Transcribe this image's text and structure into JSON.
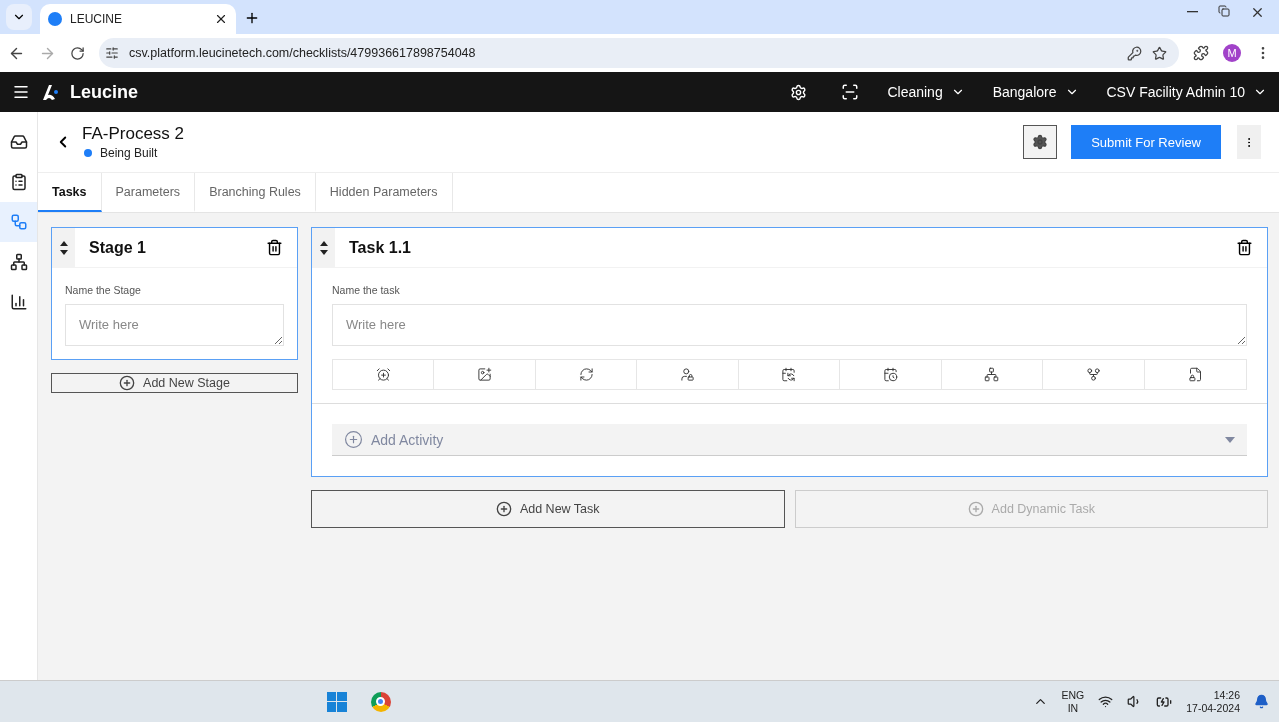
{
  "browser": {
    "tab_title": "LEUCINE",
    "url": "csv.platform.leucinetech.com/checklists/479936617898754048",
    "profile_initial": "M"
  },
  "header": {
    "brand": "Leucine",
    "menus": [
      "Cleaning",
      "Bangalore",
      "CSV Facility Admin 10"
    ]
  },
  "sidebar": {
    "items": [
      {
        "kind": "inbox",
        "selected": false
      },
      {
        "kind": "checklist",
        "selected": false
      },
      {
        "kind": "builder",
        "selected": true
      },
      {
        "kind": "hierarchy",
        "selected": false
      },
      {
        "kind": "reports",
        "selected": false
      }
    ]
  },
  "page": {
    "title": "FA-Process 2",
    "status": {
      "label": "Being Built",
      "color": "#1e7ef7"
    },
    "submit": "Submit For Review"
  },
  "tabs": [
    {
      "label": "Tasks",
      "selected": true
    },
    {
      "label": "Parameters",
      "selected": false
    },
    {
      "label": "Branching Rules",
      "selected": false
    },
    {
      "label": "Hidden Parameters",
      "selected": false
    }
  ],
  "stage": {
    "title": "Stage 1",
    "field_label": "Name the Stage",
    "placeholder": "Write here",
    "add_button": "Add New Stage"
  },
  "task": {
    "title": "Task 1.1",
    "field_label": "Name the task",
    "placeholder": "Write here",
    "add_activity": "Add Activity"
  },
  "task_buttons": [
    {
      "label": "Add New Task",
      "disabled": false
    },
    {
      "label": "Add Dynamic Task",
      "disabled": true
    }
  ],
  "taskbar": {
    "language": "ENG",
    "region": "IN",
    "time": "14:26",
    "date": "17-04-2024"
  }
}
